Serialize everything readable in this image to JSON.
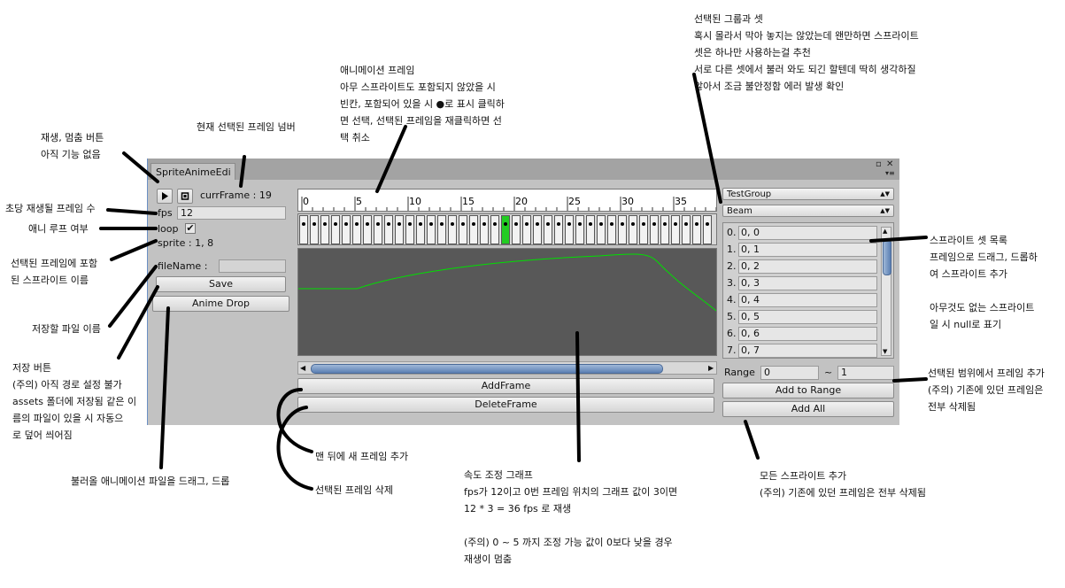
{
  "window": {
    "tab_title": "SpriteAnimeEdi"
  },
  "controls": {
    "curr_frame": "currFrame : 19",
    "fps_label": "fps",
    "fps_value": "12",
    "loop_label": "loop",
    "loop_checked": true,
    "sprite_label": "sprite : 1, 8",
    "filename_label": "fileName :",
    "filename_value": "",
    "save_label": "Save",
    "anime_drop_label": "Anime Drop"
  },
  "timeline": {
    "ruler_ticks": [
      "0",
      "5",
      "10",
      "15",
      "20",
      "25",
      "30",
      "35"
    ],
    "frame_count": 39,
    "selected_frame": 19,
    "add_frame_label": "AddFrame",
    "delete_frame_label": "DeleteFrame"
  },
  "speed_graph": {
    "curve_color": "#00e000",
    "background": "#585858"
  },
  "sprite_panel": {
    "group_select": "TestGroup",
    "set_select": "Beam",
    "items": [
      {
        "index": "0.",
        "value": "0, 0"
      },
      {
        "index": "1.",
        "value": "0, 1"
      },
      {
        "index": "2.",
        "value": "0, 2"
      },
      {
        "index": "3.",
        "value": "0, 3"
      },
      {
        "index": "4.",
        "value": "0, 4"
      },
      {
        "index": "5.",
        "value": "0, 5"
      },
      {
        "index": "6.",
        "value": "0, 6"
      },
      {
        "index": "7.",
        "value": "0, 7"
      }
    ],
    "range_label": "Range",
    "range_from": "0",
    "range_sep": "~",
    "range_to": "1",
    "add_to_range_label": "Add to Range",
    "add_all_label": "Add All"
  },
  "colors": {
    "selected_frame": "#22cc22",
    "window_bg": "#c2c2c2"
  },
  "annotations": {
    "play_stop": [
      "재생, 멈춤 버튼",
      "아직 기능 없음"
    ],
    "curr_frame": [
      "현재 선택된 프레임 넘버"
    ],
    "fps": [
      "초당 재생될 프레임 수"
    ],
    "loop": [
      "애니 루프 여부"
    ],
    "sprite": [
      "선택된 프레임에 포함",
      "된 스프라이트 이름"
    ],
    "filename": [
      "저장할 파일 이름"
    ],
    "save": [
      "저장 버튼",
      "(주의) 아직 경로 설정 불가",
      "assets 폴더에 저장됨 같은 이",
      "름의 파일이 있을 시 자동으",
      "로 덮어 씌어짐"
    ],
    "anime_drop": [
      "불러올 애니메이션 파일을 드래그, 드롭"
    ],
    "frames": [
      "애니메이션 프레임",
      "아무 스프라이트도 포함되지 않았을 시",
      "빈칸, 포함되어 있을 시 ●로 표시 클릭하",
      "면 선택, 선택된 프레임을 재클릭하면 선",
      "택 취소"
    ],
    "group_set": [
      "선택된 그룹과 셋",
      "혹시 몰라서 막아 놓지는 않았는데 왠만하면 스프라이트",
      "셋은 하나만 사용하는걸 추천",
      "서로 다른 셋에서 불러 와도 되긴 할텐데 딱히 생각하질",
      "않아서 조금 불안정함 에러 발생 확인"
    ],
    "sprite_list": [
      "스프라이트 셋 목록",
      "프레임으로 드래그, 드롭하",
      "여 스프라이트 추가",
      "",
      "아무것도 없는 스프라이트",
      "일 시 null로 표기"
    ],
    "add_range": [
      "선택된 범위에서 프레임 추가",
      "(주의) 기존에 있던 프레임은",
      "전부 삭제됨"
    ],
    "add_all": [
      "모든 스프라이트 추가",
      "(주의) 기존에 있던 프레임은 전부 삭제됨"
    ],
    "add_frame": [
      "맨 뒤에 새 프레임 추가"
    ],
    "delete_frame": [
      "선택된 프레임 삭제"
    ],
    "graph": [
      "속도 조정 그래프",
      "fps가 12이고 0번 프레임 위치의 그래프 값이 3이면",
      "12 * 3 = 36 fps 로 재생",
      "",
      "(주의) 0 ~ 5 까지 조정 가능 값이 0보다 낮을 경우",
      "재생이 멈춤"
    ]
  }
}
